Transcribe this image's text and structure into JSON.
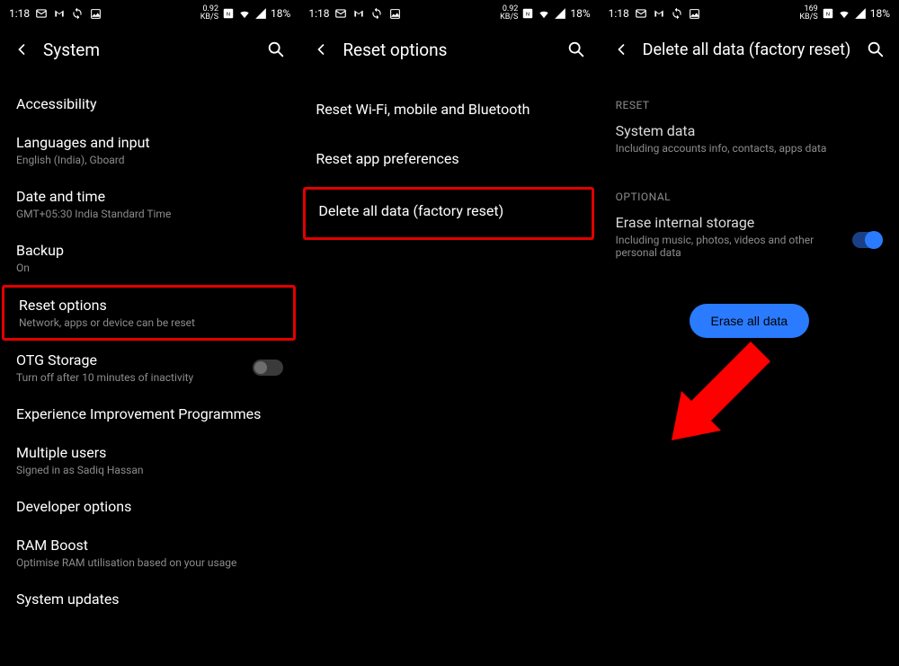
{
  "status": {
    "time": "1:18",
    "net_rate_a": "0.92",
    "net_rate_b": "169",
    "net_unit": "KB/S",
    "battery": "18%"
  },
  "panel1": {
    "title": "System",
    "items": [
      {
        "label": "Accessibility",
        "sub": ""
      },
      {
        "label": "Languages and input",
        "sub": "English (India), Gboard"
      },
      {
        "label": "Date and time",
        "sub": "GMT+05:30 India Standard Time"
      },
      {
        "label": "Backup",
        "sub": "On"
      },
      {
        "label": "Reset options",
        "sub": "Network, apps or device can be reset"
      },
      {
        "label": "OTG Storage",
        "sub": "Turn off after 10 minutes of inactivity"
      },
      {
        "label": "Experience Improvement Programmes",
        "sub": ""
      },
      {
        "label": "Multiple users",
        "sub": "Signed in as Sadiq Hassan"
      },
      {
        "label": "Developer options",
        "sub": ""
      },
      {
        "label": "RAM Boost",
        "sub": "Optimise RAM utilisation based on your usage"
      },
      {
        "label": "System updates",
        "sub": ""
      }
    ]
  },
  "panel2": {
    "title": "Reset options",
    "items": [
      {
        "label": "Reset Wi-Fi, mobile and Bluetooth"
      },
      {
        "label": "Reset app preferences"
      },
      {
        "label": "Delete all data (factory reset)"
      }
    ]
  },
  "panel3": {
    "title": "Delete all data (factory reset)",
    "section1": "RESET",
    "row1_label": "System data",
    "row1_sub": "Including accounts info, contacts, apps data",
    "section2": "OPTIONAL",
    "row2_label": "Erase internal storage",
    "row2_sub": "Including music, photos, videos and other personal data",
    "button": "Erase all data"
  }
}
